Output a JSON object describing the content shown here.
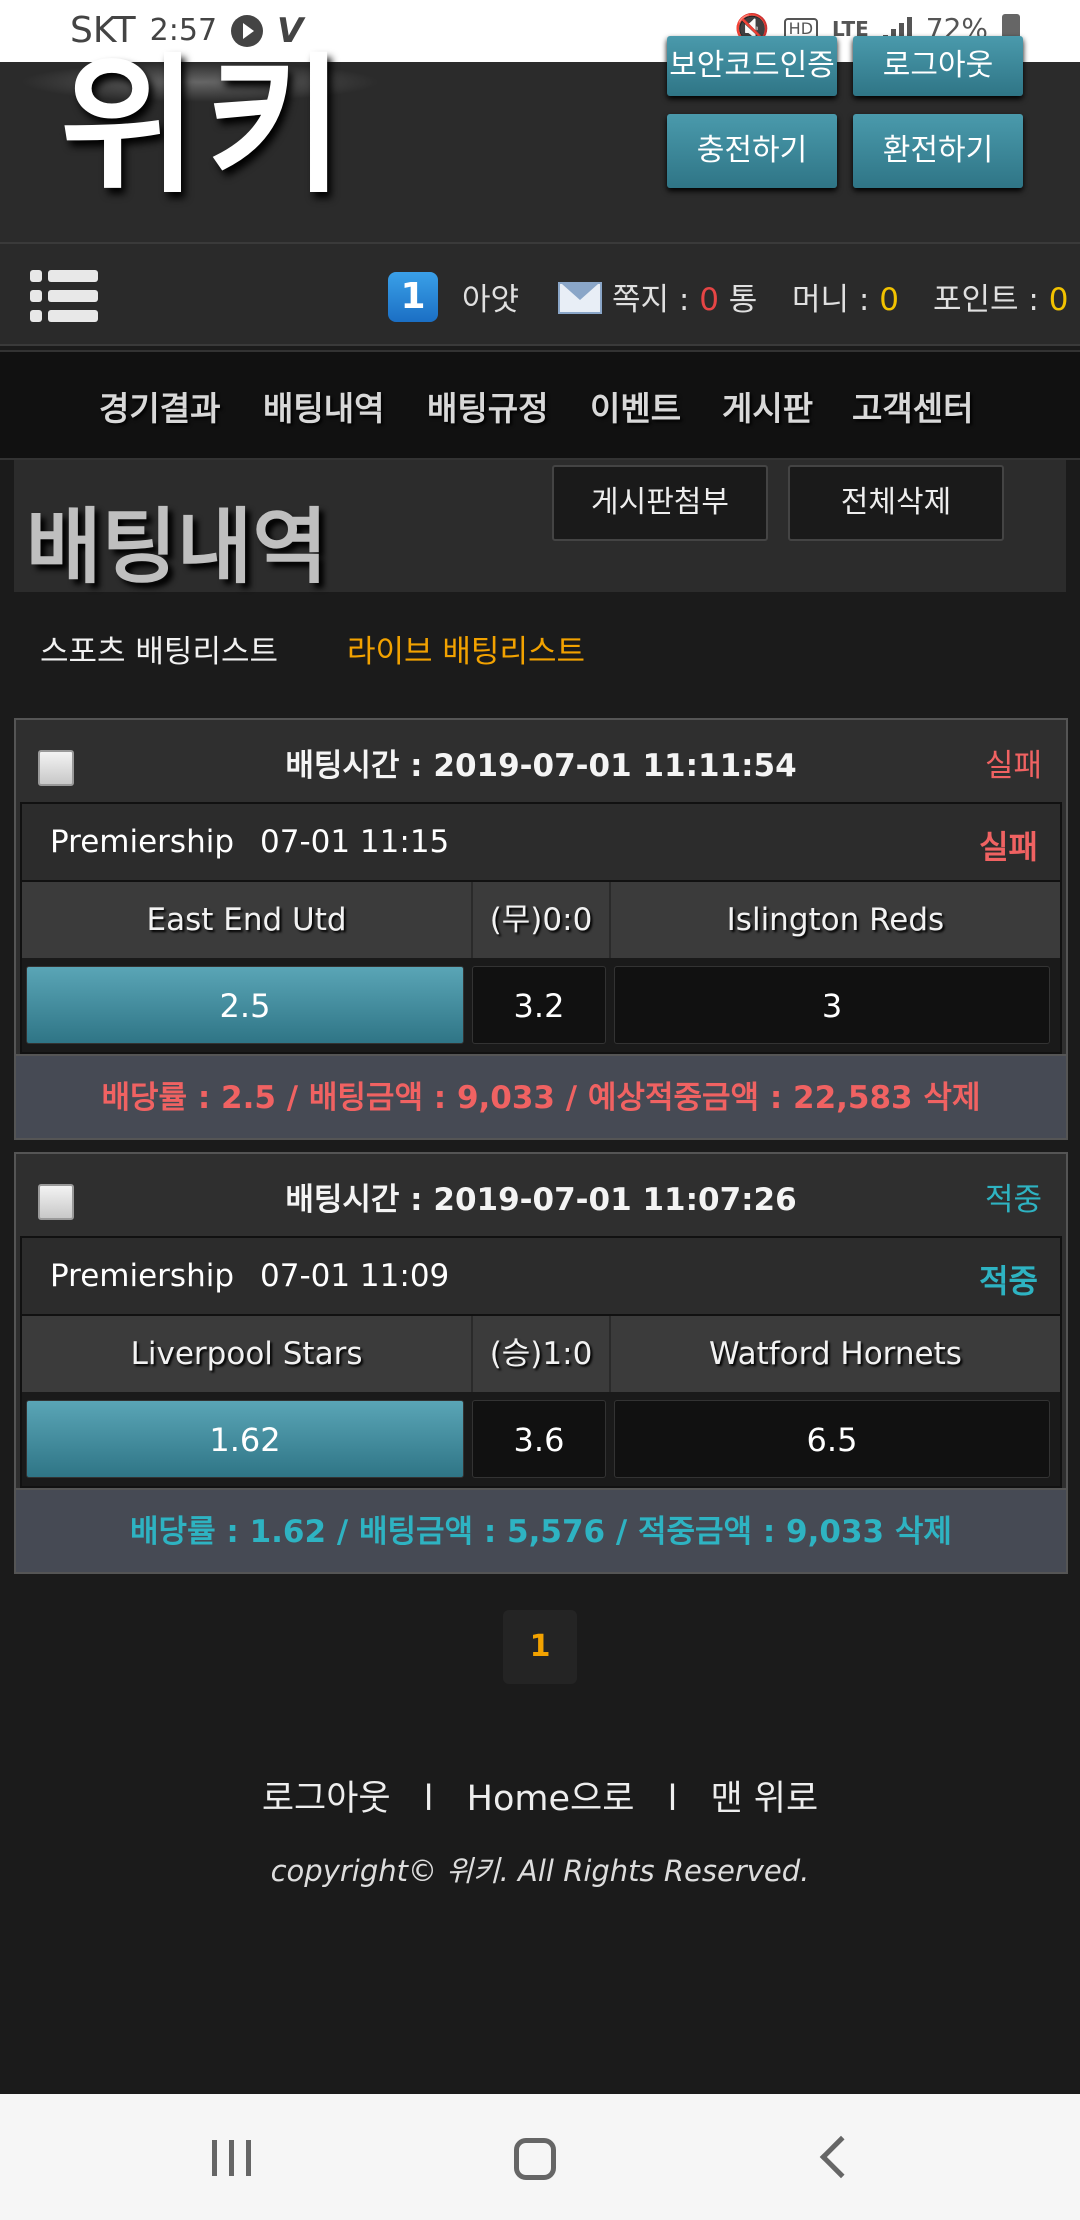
{
  "status_bar": {
    "carrier": "SKT",
    "time": "2:57",
    "battery": "72%"
  },
  "header": {
    "logo_text": "위키",
    "top_buttons": [
      "보안코드인증",
      "로그아웃"
    ],
    "charge_button": "충전하기",
    "exchange_button": "환전하기"
  },
  "user": {
    "level": "1",
    "name": "아얏",
    "note_label": "쪽지 : ",
    "note_count": "0",
    "note_unit": " 통",
    "money_label": "머니 : ",
    "money_value": "0",
    "point_label": "포인트 : ",
    "point_value": "0"
  },
  "nav": [
    "경기결과",
    "배팅내역",
    "배팅규정",
    "이벤트",
    "게시판",
    "고객센터"
  ],
  "page": {
    "title": "배팅내역",
    "attach_button": "게시판첨부",
    "delete_all_button": "전체삭제",
    "tab_sports": "스포츠 배팅리스트",
    "tab_live": "라이브 배팅리스트"
  },
  "colors": {
    "accent": "#f2a200",
    "fail": "#f06262",
    "win": "#2eb3c2",
    "selected_odd": "#3e8e9f"
  },
  "bets": [
    {
      "bet_time": "배팅시간 : 2019-07-01 11:11:54",
      "result": "실패",
      "league": "Premiership",
      "match_time": "07-01 11:15",
      "home": "East End Utd",
      "mid": "(무)0:0",
      "away": "Islington Reds",
      "odd_home": "2.5",
      "odd_mid": "3.2",
      "odd_away": "3",
      "summary": "배당률 : 2.5 / 배팅금액 : 9,033 / 예상적중금액 : 22,583 삭제"
    },
    {
      "bet_time": "배팅시간 : 2019-07-01 11:07:26",
      "result": "적중",
      "league": "Premiership",
      "match_time": "07-01 11:09",
      "home": "Liverpool Stars",
      "mid": "(승)1:0",
      "away": "Watford Hornets",
      "odd_home": "1.62",
      "odd_mid": "3.6",
      "odd_away": "6.5",
      "summary": "배당률 : 1.62 / 배팅금액 : 5,576 / 적중금액 : 9,033 삭제"
    }
  ],
  "pagination": {
    "current": "1"
  },
  "footer": {
    "logout": "로그아웃",
    "home": "Home으로",
    "top": "맨 위로",
    "sep": "l",
    "copyright": "copyright© 위키. All Rights Reserved."
  }
}
